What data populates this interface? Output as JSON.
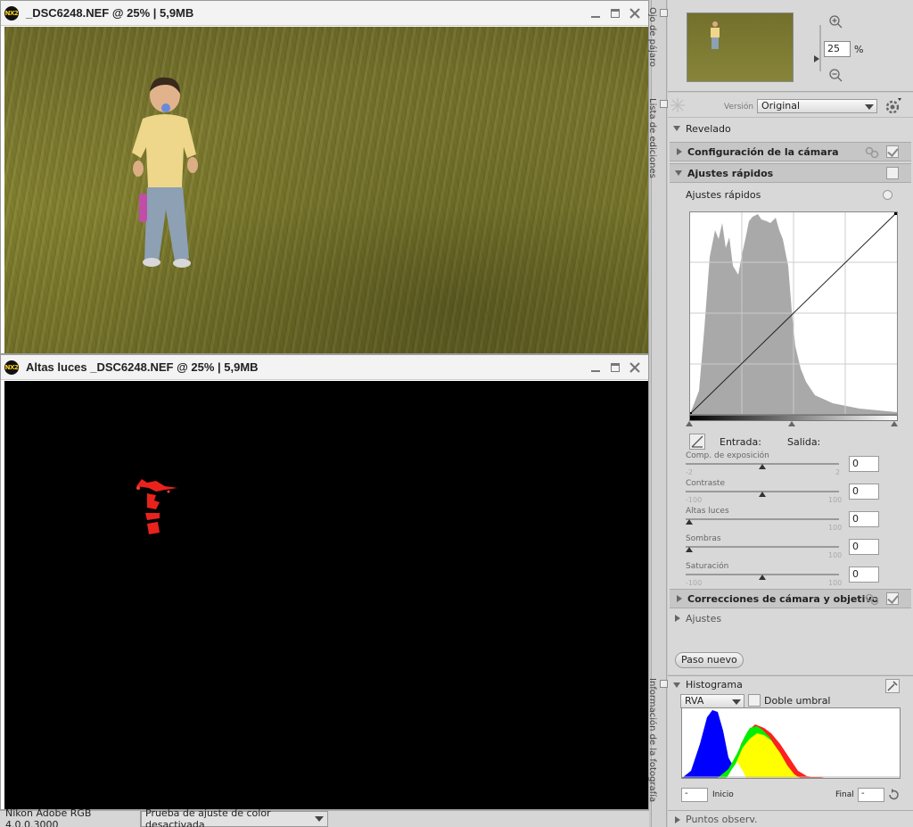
{
  "window1": {
    "title": "_DSC6248.NEF @ 25% | 5,9MB",
    "logo": "NX2"
  },
  "window2": {
    "title": "Altas luces _DSC6248.NEF @ 25% | 5,9MB",
    "logo": "NX2"
  },
  "statusbar": {
    "profile": "Nikon Adobe RGB 4.0.0.3000",
    "proof": "Prueba de ajuste de color desactivada"
  },
  "vtabs": {
    "birdseye": "Ojo de pájaro",
    "editlist": "Lista de ediciones",
    "info": "Información de la fotografía"
  },
  "birdseye": {
    "zoom_value": "25",
    "zoom_unit": "%"
  },
  "edit": {
    "version_label": "Versión",
    "version_value": "Original",
    "revelado": "Revelado",
    "camera_settings": "Configuración de la cámara",
    "quick_adjust": "Ajustes rápidos",
    "quick_adjust_sub": "Ajustes rápidos",
    "input_label": "Entrada:",
    "output_label": "Salida:",
    "controls": [
      {
        "label": "Comp. de exposición",
        "min": "-2",
        "max": "2",
        "value": "0",
        "pos": 0.5
      },
      {
        "label": "Contraste",
        "min": "-100",
        "max": "100",
        "value": "0",
        "pos": 0.5
      },
      {
        "label": "Altas luces",
        "min": "",
        "max": "100",
        "value": "0",
        "pos": 0.0
      },
      {
        "label": "Sombras",
        "min": "",
        "max": "100",
        "value": "0",
        "pos": 0.0
      },
      {
        "label": "Saturación",
        "min": "-100",
        "max": "100",
        "value": "0",
        "pos": 0.5
      }
    ],
    "camera_lens": "Correcciones de cámara y objetivo",
    "ajustes": "Ajustes",
    "new_step": "Paso nuevo"
  },
  "histogram": {
    "title": "Histograma",
    "channel": "RVA",
    "double_threshold": "Doble umbral",
    "start_value": "-",
    "start_label": "Inicio",
    "end_label": "Final",
    "end_value": "-",
    "puntos": "Puntos observ."
  }
}
